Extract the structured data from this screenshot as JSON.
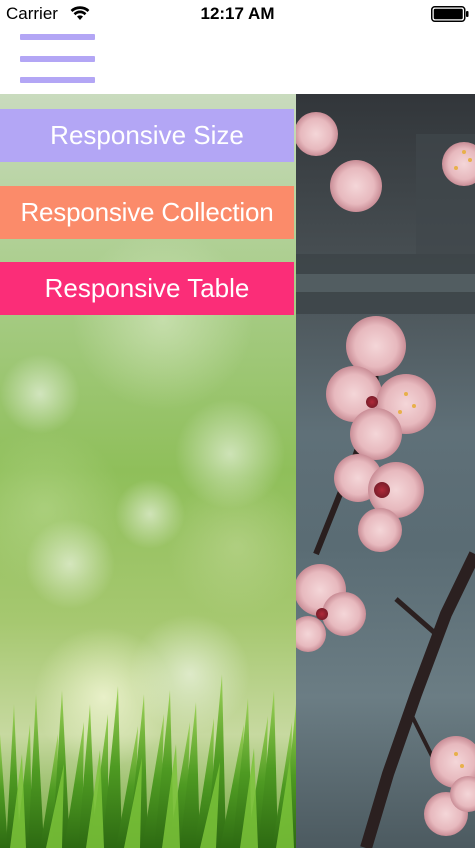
{
  "status_bar": {
    "carrier": "Carrier",
    "time": "12:17 AM",
    "wifi_icon": "wifi-icon",
    "battery_icon": "battery-icon"
  },
  "top_bar": {
    "menu_icon": "hamburger-menu-icon",
    "accent_color": "#b3a6f5"
  },
  "side_menu": {
    "items": [
      {
        "label": "Responsive Size",
        "color": "#b3a6f5"
      },
      {
        "label": "Responsive Collection",
        "color": "#fb8b6a"
      },
      {
        "label": "Responsive Table",
        "color": "#fb2d78"
      }
    ]
  }
}
